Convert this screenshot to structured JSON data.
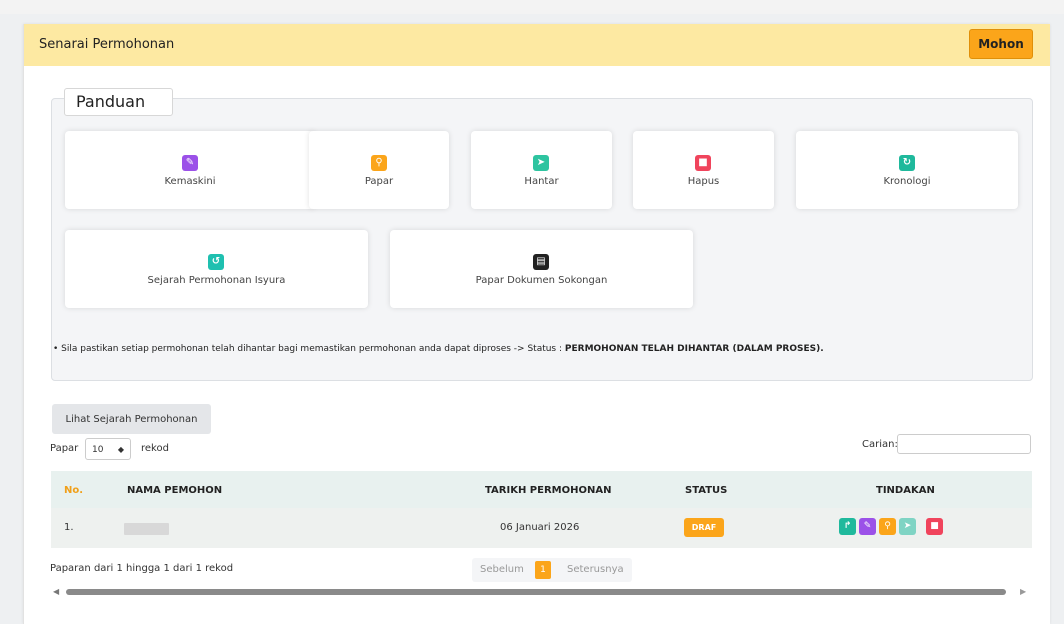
{
  "header": {
    "title": "Senarai Permohonan",
    "apply_button": "Mohon"
  },
  "guide": {
    "legend": "Panduan",
    "items": [
      {
        "label": "Kemaskini",
        "icon": "edit-icon",
        "color": "#9b51e8"
      },
      {
        "label": "Papar",
        "icon": "search-icon",
        "color": "#fba51a"
      },
      {
        "label": "Hantar",
        "icon": "send-icon",
        "color": "#2ec4a0"
      },
      {
        "label": "Hapus",
        "icon": "trash-icon",
        "color": "#f0445c"
      },
      {
        "label": "Kronologi",
        "icon": "refresh-icon",
        "color": "#1fb99c"
      },
      {
        "label": "Sejarah Permohonan Isyura",
        "icon": "history-icon",
        "color": "#1fc0b0"
      },
      {
        "label": "Papar Dokumen Sokongan",
        "icon": "document-icon",
        "color": "#222222"
      }
    ],
    "note_prefix": "• Sila pastikan setiap permohonan telah dihantar bagi memastikan permohonan anda dapat diproses -> Status : ",
    "note_status": "PERMOHONAN TELAH DIHANTAR (DALAM PROSES)."
  },
  "history_button": "Lihat Sejarah Permohonan",
  "length_menu": {
    "prefix": "Papar",
    "value": "10",
    "suffix": "rekod"
  },
  "search": {
    "label": "Carian:",
    "value": ""
  },
  "table": {
    "columns": [
      "No.",
      "NAMA PEMOHON",
      "TARIKH PERMOHONAN",
      "STATUS",
      "TINDAKAN"
    ],
    "rows": [
      {
        "no": "1.",
        "name": "",
        "date": "06 Januari 2026",
        "status": "DRAF"
      }
    ]
  },
  "info": "Paparan dari 1 hingga 1 dari 1 rekod",
  "pagination": {
    "previous": "Sebelum",
    "current": "1",
    "next": "Seterusnya"
  },
  "colors": {
    "accent": "#fba51a",
    "header_bg": "#fde9a2"
  }
}
